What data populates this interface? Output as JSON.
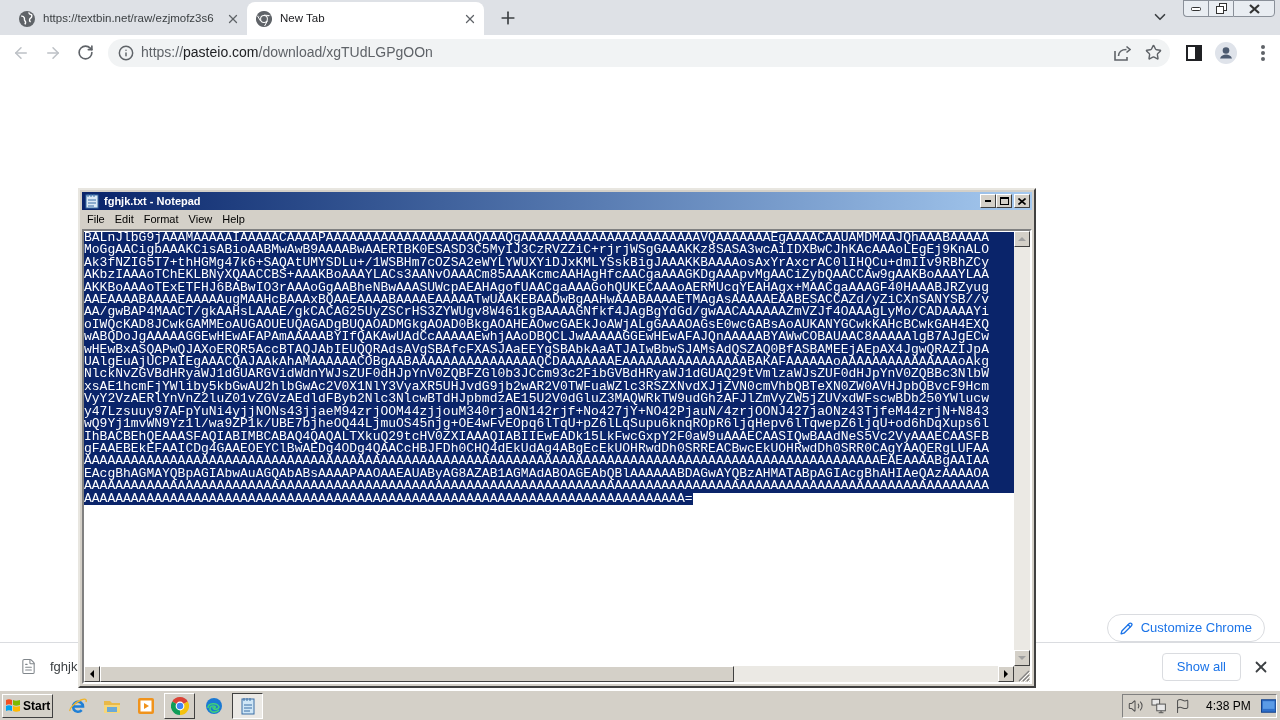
{
  "browser": {
    "tabs": [
      {
        "title": "https://textbin.net/raw/ezjmofz3s6",
        "kind": "web",
        "selected": false
      },
      {
        "title": "New Tab",
        "kind": "newtab",
        "selected": true
      }
    ],
    "nav_buttons": [
      {
        "kind": "back",
        "disabled": true
      },
      {
        "kind": "forward",
        "disabled": true
      },
      {
        "kind": "reload",
        "disabled": false
      }
    ],
    "address_bar": {
      "scheme": "https://",
      "host": "pasteio.com",
      "path": "/download/xgTUdLGPgOOn"
    },
    "customize_button": "Customize Chrome",
    "download_bar": {
      "items": [
        {
          "name": "fghjk"
        }
      ],
      "show_all": "Show all"
    }
  },
  "notepad": {
    "title": "fghjk.txt - Notepad",
    "menu": [
      "File",
      "Edit",
      "Format",
      "View",
      "Help"
    ],
    "text_selected": true,
    "lines": [
      "BALnJlbG9jAAAMAAAAAIAAAAACAAAAPAAAAAAAAAAAAAAAAAAAQAAAQgAAAAAAAAAAAAAAAAAAAAAAAVQAAAAAAAEgAAAACAAUAMDMAAJQhAAABAAAAA",
      "MoGgAACigbAAAKCisABioAABMwAwB9AAAABwAAERIBK0ESASD3C5MyIJ3CzRVZZiC+rjrjWSgGAAAKKz8SASA3wcAiIDXBwCJhKAcAAAoLEgEj9KnALO",
      "Ak3fNZIG5T7+thHGMg47k6+SAQAtUMYSDLu+/1WSBHm7cOZSA2eWYLYWUXYiDJxKMLYSskBigJAAAKKBAAAAosAxYrAxcrAC0lIHQCu+dmIIv9RBhZCy",
      "AKbzIAAAoTChEKLBNyXQAACCBS+AAAKBoAAAYLACs3AANvOAAACm85AAAKcmcAAHAgHfcAACgaAAAGKDgAAApvMgAACiZybQAACCAw9gAAKBoAAAYLAA",
      "AKKBoAAAoTExETFHJ6BABwIO3rAAAoGgAABheNBwAAASUWcpAEAHAgofUAACgaAAAGohQUKECAAAoAERMUcqYEAHAgx+MAACgaAAAGF40HAAABJRZyug",
      "AAEAAAABAAAAEAAAAAugMAAHcBAAAxBQAAEAAAABAAAAEAAAAATwUAAKEBAADwBgAAHwAAABAAAAETMAgAsAAAAAEAABESACCAZd/yZiCXnSANYSB//v",
      "AA/gwBAP4MAACT/gkAAHsLAAAE/gkCACAG25UyZSCrHS3ZYWUgv8W461kgBAAAAGNfkf4JAgBgYdGd/gwAACAAAAAAZmVZJf4OAAAgLyMo/CADAAAAYi",
      "oIWQcKAD8JCwkGAMMEoAUGAOUEUQAGADgBUQAOADMGkgAOAD0BkgAOAHEAOwcGAEkJoAWjALgGAAAOAGsE0wcGABsAoAUKANYGCwkKAHcBCwkGAH4EXQ",
      "wABQDoJgAAAAAGGEwHEwAFAPAmAAAAABYIfQAKAwUAdCcAAAAAEwhjAAoDBQCLJwAAAAAGGEwHEwAFAJQnAAAAABYAWwCOBAUAAC8AAAAAlgB7AJgECw",
      "wHEwBxASQAPwQJAXoERQR5AccBTAQJAbIEUQQRAdsAVgSBAfcFXASJAaEEYgSBAbkAaATJAIwBbwSJAMsAdQSZAQ0BfASBAMEEjAEpAX4JgwQRAZIJpA",
      "UAlgEuAjUCPAIEgAAACQAJAAkAhAMAAAAAACOBgAABAAAAAAAAAAAAAAAAQCDAAAAAAAEAAAAAAAAAAAAAAAABAKAFAAAAAAoAAAAAAAAAAAAAAAoAkg",
      "NlckNvZGVBdHRyaWJ1dGUARGVidWdnYWJsZUF0dHJpYnV0ZQBFZGl0b3JCcm93c2FibGVBdHRyaWJ1dGUAQ29tVmlzaWJsZUF0dHJpYnV0ZQBBc3NlbW",
      "xsAE1hcmFjYWliby5kbGwAU2hlbGwAc2V0X1NlY3VyaXR5UHJvdG9jb2wAR2V0TWFuaWZlc3RSZXNvdXJjZVN0cmVhbQBTeXN0ZW0AVHJpbQBvcF9Hcm",
      "VyY2VzAERlYnVnZ2luZ01vZGVzAEdldFByb2Nlc3NlcwBTdHJpbmdzAE15U2V0dGluZ3MAQWRkTW9udGhzAFJlZmVyZW5jZUVxdWFscwBDb250YWlucw",
      "y47Lzsuuy97AFpYuNi4yjjNONs43jjaeM94zrjOOM44zjjouM340rjaON142rjf+No427jY+NO42PjauN/4zrjOONJ427jaONz43TjfeM44zrjN+N843",
      "wQ9Yj1mvWN9Yz1l/wa9ZP1k/UBE7bjheOQ44LjmuOS45njg+OE4wFvEOpq6lTqU+pZ6lLqSupu6knqROpR6ljqHepv6lTqwepZ6ljqU+od6hDqXups6l",
      "IhBACBEhQEAAASFAQIABIMBCABAQ4QAQALTXkuQ29tcHV0ZXIAAAQIABIIEwEADk15LkFwcGxpY2F0aW9uAAAECAASIQwBAAdNeS5Vc2VyAAAECAASFB",
      "gFAAEBEkEFAAICDg4GAAEOEYClBwAEDg4ODg4QAACcHBJFDh0CHQ4dEkUdAg4ABgEcEkUOHRwdDh0SRREACBwcEkUOHRwdDh0SRR0CAgYAAQERgLUFAA",
      "AAAAAAAAAAAAAAAAAAAAAAAAAAAAAAAAAAAAAAAAAAAAAAAAAAAAAAAAAAAAAAAAAAAAAAAAAAAAAAAAAAAAAAAAAAAAAAAAAAAAAAEAEAAAABgAAIAA",
      "EAcgBhAGMAYQBpAGIAbwAuAGQAbABsAAAAPAAOAAEAUAByAG8AZAB1AGMAdABOAGEAbQBlAAAAAABDAGwAYQBzAHMATABpAGIAcgBhAHIAeQAzAAAAOA",
      "AAAAAAAAAAAAAAAAAAAAAAAAAAAAAAAAAAAAAAAAAAAAAAAAAAAAAAAAAAAAAAAAAAAAAAAAAAAAAAAAAAAAAAAAAAAAAAAAAAAAAAAAAAAAAAAAAAAA",
      "AAAAAAAAAAAAAAAAAAAAAAAAAAAAAAAAAAAAAAAAAAAAAAAAAAAAAAAAAAAAAAAAAAAAAAAAAAAAA="
    ]
  },
  "taskbar": {
    "start": "Start",
    "apps": [
      {
        "kind": "ie",
        "open": false,
        "selected": false
      },
      {
        "kind": "explorer",
        "open": false,
        "selected": false
      },
      {
        "kind": "media",
        "open": false,
        "selected": false
      },
      {
        "kind": "chrome",
        "open": true,
        "selected": false
      },
      {
        "kind": "edge",
        "open": false,
        "selected": false
      },
      {
        "kind": "notepad",
        "open": true,
        "selected": true
      }
    ],
    "clock": "4:38 PM"
  }
}
